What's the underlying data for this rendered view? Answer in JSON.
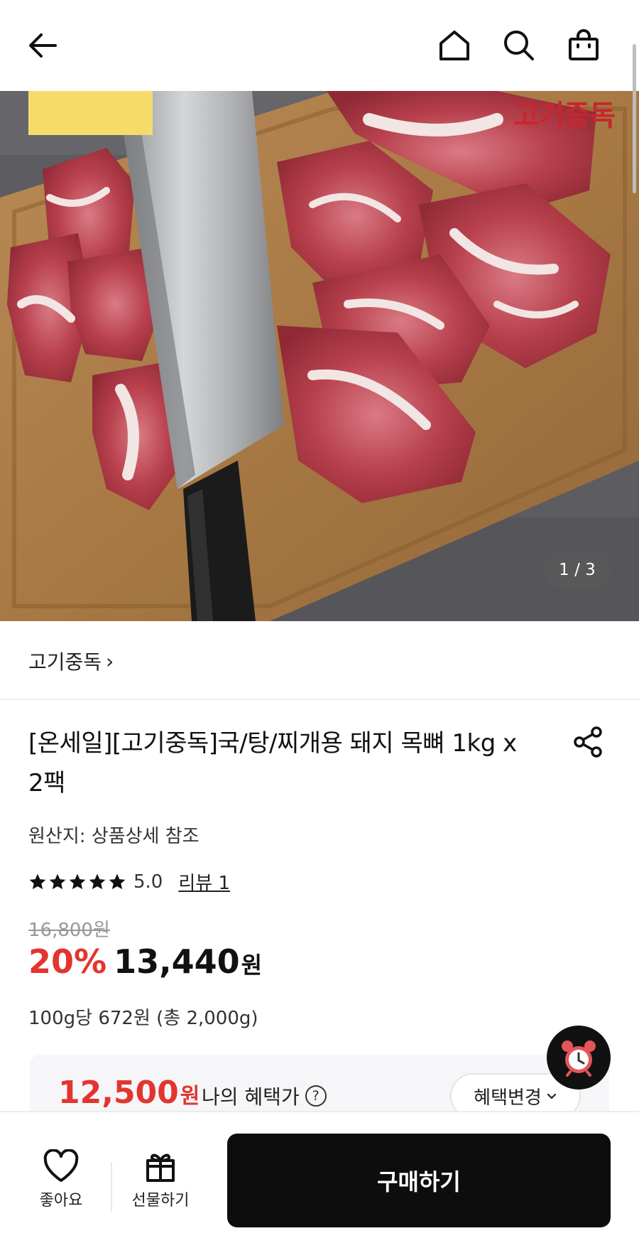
{
  "header": {
    "back_icon": "arrow-left-icon",
    "home_icon": "home-icon",
    "search_icon": "search-icon",
    "cart_icon": "shopping-bag-icon"
  },
  "hero": {
    "brand_stamp": "고기중독",
    "counter": "1 / 3"
  },
  "store": {
    "name": "고기중독",
    "chevron": "›"
  },
  "product": {
    "title": "[온세일][고기중독]국/탕/찌개용 돼지 목뼈 1kg x 2팩",
    "origin": "원산지: 상품상세 참조",
    "rating": "5.0",
    "stars": 5,
    "review_link": "리뷰 1",
    "original_price": "16,800원",
    "discount": "20%",
    "price": "13,440",
    "price_unit": "원",
    "unit_price": "100g당 672원 (총 2,000g)"
  },
  "benefit": {
    "price": "12,500",
    "price_unit": "원",
    "label": "나의 혜택가",
    "help_glyph": "?",
    "change_button": "혜택변경"
  },
  "bottom_bar": {
    "like_label": "좋아요",
    "gift_label": "선물하기",
    "buy_label": "구매하기"
  },
  "colors": {
    "accent_red": "#e3342f",
    "buy_button": "#0d0d0d"
  }
}
